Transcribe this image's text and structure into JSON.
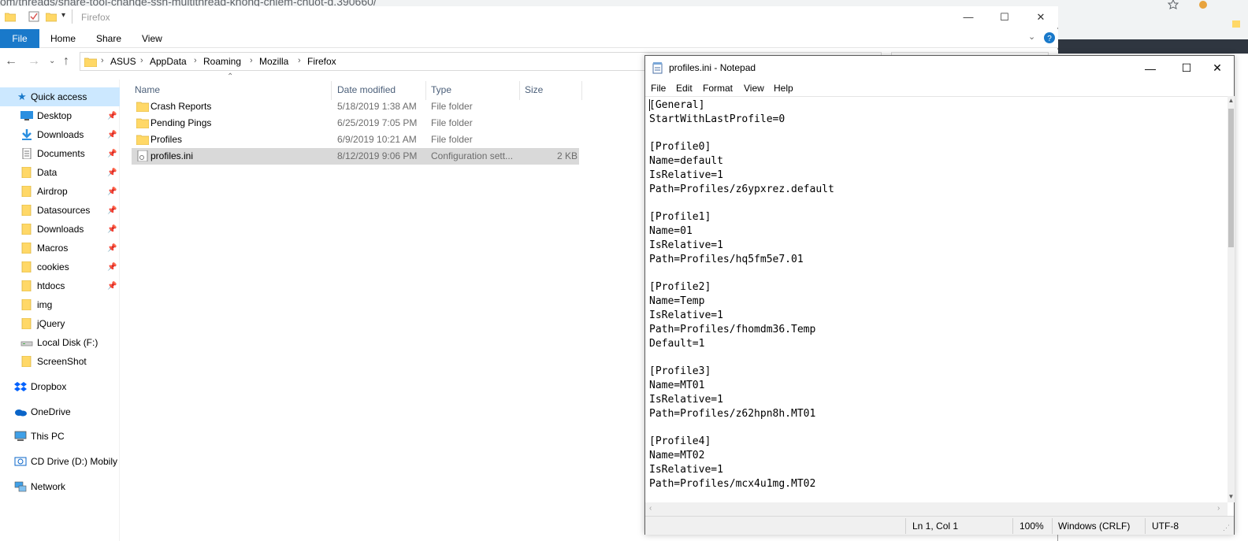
{
  "browser": {
    "url_fragment": "om/threads/share-tool-change-ssh-multithread-khong-chiem-chuot-d.390660/"
  },
  "explorer": {
    "title": "Firefox",
    "ribbon": {
      "file": "File",
      "home": "Home",
      "share": "Share",
      "view": "View"
    },
    "breadcrumb": [
      "ASUS",
      "AppData",
      "Roaming",
      "Mozilla",
      "Firefox"
    ],
    "columns": {
      "name": "Name",
      "date": "Date modified",
      "type": "Type",
      "size": "Size"
    },
    "files": [
      {
        "name": "Crash Reports",
        "date": "5/18/2019 1:38 AM",
        "type": "File folder",
        "size": ""
      },
      {
        "name": "Pending Pings",
        "date": "6/25/2019 7:05 PM",
        "type": "File folder",
        "size": ""
      },
      {
        "name": "Profiles",
        "date": "6/9/2019 10:21 AM",
        "type": "File folder",
        "size": ""
      },
      {
        "name": "profiles.ini",
        "date": "8/12/2019 9:06 PM",
        "type": "Configuration sett...",
        "size": "2 KB"
      }
    ],
    "nav": {
      "quick_access": "Quick access",
      "pinned": [
        "Desktop",
        "Downloads",
        "Documents",
        "Data",
        "Airdrop",
        "Datasources",
        "Downloads",
        "Macros",
        "cookies",
        "htdocs"
      ],
      "unpinned": [
        "img",
        "jQuery",
        "Local Disk (F:)",
        "ScreenShot"
      ],
      "dropbox": "Dropbox",
      "onedrive": "OneDrive",
      "this_pc": "This PC",
      "cd_drive": "CD Drive (D:) Mobily",
      "network": "Network"
    }
  },
  "notepad": {
    "title": "profiles.ini - Notepad",
    "menu": {
      "file": "File",
      "edit": "Edit",
      "format": "Format",
      "view": "View",
      "help": "Help"
    },
    "lines": [
      "[General]",
      "StartWithLastProfile=0",
      "",
      "[Profile0]",
      "Name=default",
      "IsRelative=1",
      "Path=Profiles/z6ypxrez.default",
      "",
      "[Profile1]",
      "Name=01",
      "IsRelative=1",
      "Path=Profiles/hq5fm5e7.01",
      "",
      "[Profile2]",
      "Name=Temp",
      "IsRelative=1",
      "Path=Profiles/fhomdm36.Temp",
      "Default=1",
      "",
      "[Profile3]",
      "Name=MT01",
      "IsRelative=1",
      "Path=Profiles/z62hpn8h.MT01",
      "",
      "[Profile4]",
      "Name=MT02",
      "IsRelative=1",
      "Path=Profiles/mcx4u1mg.MT02"
    ],
    "status": {
      "position": "Ln 1, Col 1",
      "zoom": "100%",
      "line_ending": "Windows (CRLF)",
      "encoding": "UTF-8"
    }
  },
  "colors": {
    "accent": "#1979ca",
    "selection": "#cce8ff",
    "folder": "#ffd867"
  }
}
